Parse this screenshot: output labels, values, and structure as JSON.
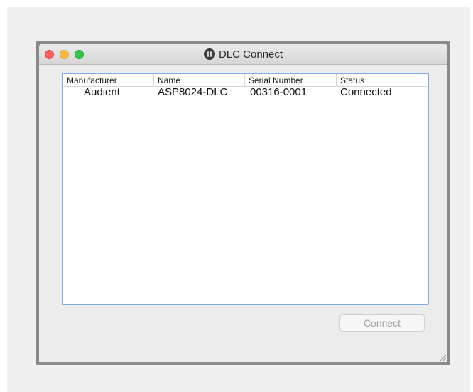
{
  "window": {
    "title": "DLC Connect",
    "app_icon": "dlc-app-icon"
  },
  "table": {
    "columns": [
      "Manufacturer",
      "Name",
      "Serial Number",
      "Status"
    ],
    "rows": [
      [
        "Audient",
        "ASP8024-DLC",
        "00316-0001",
        "Connected"
      ]
    ]
  },
  "buttons": {
    "connect_label": "Connect",
    "connect_enabled": false
  },
  "colors": {
    "focus_ring": "#7eaee8",
    "close": "#fc605c",
    "minimize": "#fdbc40",
    "maximize": "#34c84a"
  }
}
